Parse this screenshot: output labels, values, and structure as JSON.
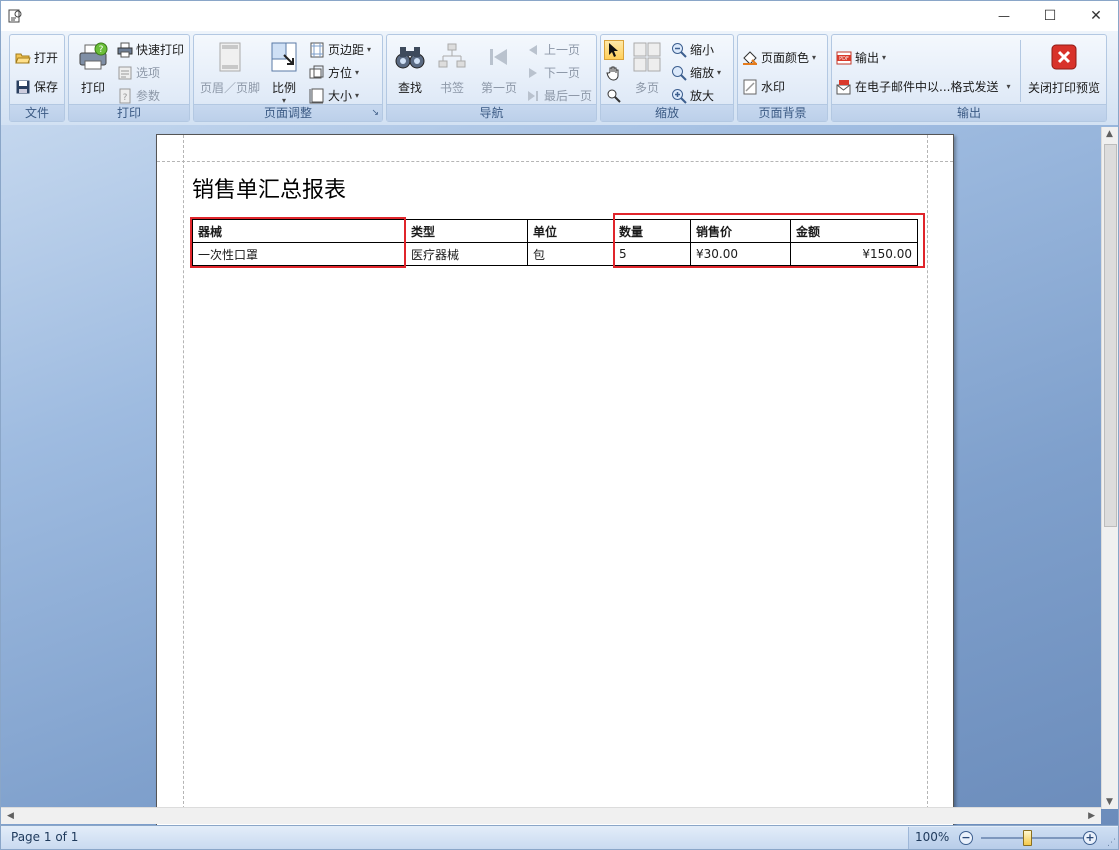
{
  "window": {
    "minimize": "—",
    "maximize": "☐",
    "close": "✕"
  },
  "ribbon": {
    "file_group": {
      "label": "文件",
      "open": "打开",
      "save": "保存"
    },
    "print_group": {
      "label": "打印",
      "print": "打印",
      "quick_print": "快速打印",
      "options": "选项",
      "parameters": "参数"
    },
    "page_setup_group": {
      "label": "页面调整",
      "header_footer": "页眉／页脚",
      "scale": "比例",
      "margins": "页边距",
      "orientation": "方位",
      "size": "大小"
    },
    "navigation_group": {
      "label": "导航",
      "find": "查找",
      "bookmark": "书签",
      "first_page": "第一页",
      "prev_page": "上一页",
      "next_page": "下一页",
      "last_page": "最后一页"
    },
    "zoom_group": {
      "label": "缩放",
      "multi_page": "多页",
      "zoom_out": "缩小",
      "zoom": "缩放",
      "zoom_in": "放大"
    },
    "background_group": {
      "label": "页面背景",
      "page_color": "页面颜色",
      "watermark": "水印"
    },
    "export_group": {
      "label": "输出",
      "export": "输出",
      "email_send": "在电子邮件中以...格式发送",
      "close_preview": "关闭打印预览"
    }
  },
  "report": {
    "title": "销售单汇总报表",
    "columns": [
      "器械",
      "类型",
      "单位",
      "数量",
      "销售价",
      "金额"
    ],
    "rows": [
      [
        "一次性口罩",
        "医疗器械",
        "包",
        "5",
        "¥30.00",
        "¥150.00"
      ]
    ]
  },
  "statusbar": {
    "page_indicator": "Page 1 of 1",
    "zoom_level": "100%",
    "zoom_level_value": 100
  },
  "colors": {
    "highlight": "#e0252b",
    "ribbon_label": "#3b5a84",
    "workspace": "#7fa0cc"
  }
}
